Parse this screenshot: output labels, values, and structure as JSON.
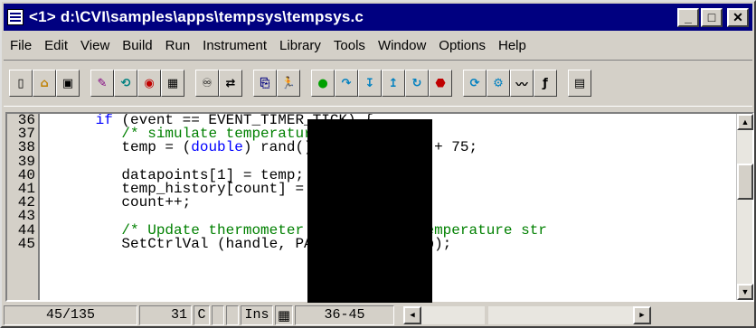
{
  "window": {
    "title": "<1> d:\\CVI\\samples\\apps\\tempsys\\tempsys.c",
    "min_label": "_",
    "max_label": "□",
    "close_label": "✕"
  },
  "menu": [
    "File",
    "Edit",
    "View",
    "Build",
    "Run",
    "Instrument",
    "Library",
    "Tools",
    "Window",
    "Options",
    "Help"
  ],
  "toolbar": {
    "groups": [
      [
        "new-icon",
        "open-icon",
        "save-icon"
      ],
      [
        "edit-icon",
        "recall-icon",
        "find-icon",
        "panel-icon"
      ],
      [
        "binoculars-icon",
        "replace-icon"
      ],
      [
        "copy-icon",
        "run-icon"
      ],
      [
        "go-icon",
        "step-over-icon",
        "step-into-icon",
        "finish-icon",
        "continue-icon",
        "stop-icon"
      ],
      [
        "watch-icon",
        "variables-icon",
        "graph-icon",
        "function-icon"
      ],
      [
        "doc-icon"
      ]
    ]
  },
  "editor": {
    "line_numbers": [
      "36",
      "37",
      "38",
      "39",
      "40",
      "41",
      "42",
      "43",
      "44",
      "45"
    ],
    "lines": [
      {
        "pre": "      ",
        "kw": "if",
        "post": " (event == EVENT_TIMER_TICK) {"
      },
      {
        "pre": "         ",
        "comment": "/* simulate temperature reading */"
      },
      {
        "pre": "         temp = (",
        "kw": "double",
        "post": ") rand()/RAND_MAX * 5 + 75;"
      },
      {
        "pre": ""
      },
      {
        "pre": "         datapoints[1] = temp;"
      },
      {
        "pre": "         temp_history[count] = temp;"
      },
      {
        "pre": "         count++;"
      },
      {
        "pre": ""
      },
      {
        "pre": "         ",
        "comment": "/* Update thermometer control and temperature str"
      },
      {
        "pre": "         SetCtrlVal (handle, PANEL_TEMP, temp);"
      }
    ]
  },
  "status": {
    "position": "45/135",
    "column": "31",
    "c_label": "C",
    "ins_label": "Ins",
    "range": "36-45"
  }
}
